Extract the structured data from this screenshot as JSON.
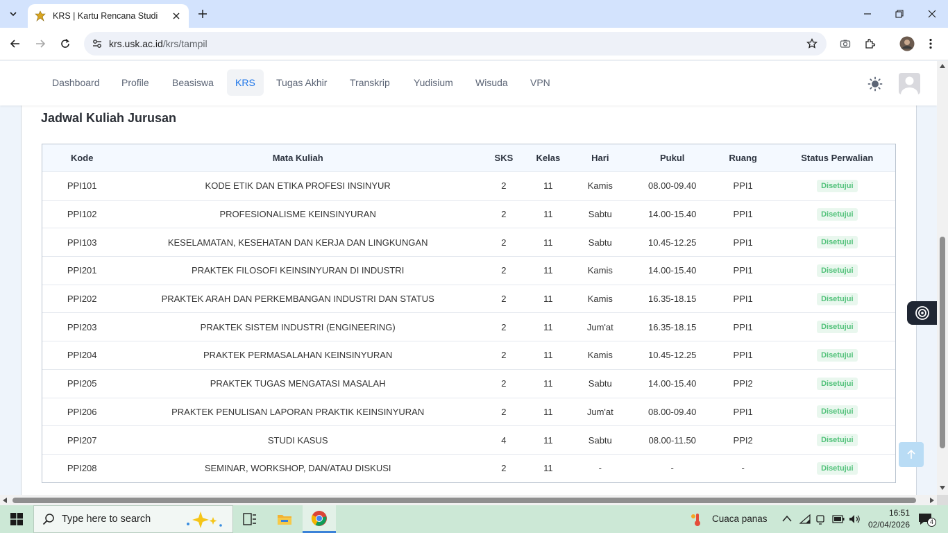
{
  "browser": {
    "tab_title": "KRS | Kartu Rencana Studi",
    "url_host": "krs.usk.ac.id",
    "url_path": "/krs/tampil"
  },
  "nav": {
    "items": [
      {
        "label": "Dashboard"
      },
      {
        "label": "Profile"
      },
      {
        "label": "Beasiswa"
      },
      {
        "label": "KRS"
      },
      {
        "label": "Tugas Akhir"
      },
      {
        "label": "Transkrip"
      },
      {
        "label": "Yudisium"
      },
      {
        "label": "Wisuda"
      },
      {
        "label": "VPN"
      }
    ],
    "active": "KRS"
  },
  "section": {
    "title": "Jadwal Kuliah Jurusan"
  },
  "table": {
    "headers": [
      "Kode",
      "Mata Kuliah",
      "SKS",
      "Kelas",
      "Hari",
      "Pukul",
      "Ruang",
      "Status Perwalian"
    ],
    "rows": [
      {
        "kode": "PPI101",
        "mk": "KODE ETIK DAN ETIKA PROFESI INSINYUR",
        "sks": "2",
        "kelas": "11",
        "hari": "Kamis",
        "pukul": "08.00-09.40",
        "ruang": "PPI1",
        "status": "Disetujui"
      },
      {
        "kode": "PPI102",
        "mk": "PROFESIONALISME KEINSINYURAN",
        "sks": "2",
        "kelas": "11",
        "hari": "Sabtu",
        "pukul": "14.00-15.40",
        "ruang": "PPI1",
        "status": "Disetujui"
      },
      {
        "kode": "PPI103",
        "mk": "KESELAMATAN, KESEHATAN DAN KERJA DAN LINGKUNGAN",
        "sks": "2",
        "kelas": "11",
        "hari": "Sabtu",
        "pukul": "10.45-12.25",
        "ruang": "PPI1",
        "status": "Disetujui"
      },
      {
        "kode": "PPI201",
        "mk": "PRAKTEK FILOSOFI KEINSINYURAN DI INDUSTRI",
        "sks": "2",
        "kelas": "11",
        "hari": "Kamis",
        "pukul": "14.00-15.40",
        "ruang": "PPI1",
        "status": "Disetujui"
      },
      {
        "kode": "PPI202",
        "mk": "PRAKTEK ARAH DAN PERKEMBANGAN INDUSTRI DAN STATUS",
        "sks": "2",
        "kelas": "11",
        "hari": "Kamis",
        "pukul": "16.35-18.15",
        "ruang": "PPI1",
        "status": "Disetujui"
      },
      {
        "kode": "PPI203",
        "mk": "PRAKTEK SISTEM INDUSTRI (ENGINEERING)",
        "sks": "2",
        "kelas": "11",
        "hari": "Jum'at",
        "pukul": "16.35-18.15",
        "ruang": "PPI1",
        "status": "Disetujui"
      },
      {
        "kode": "PPI204",
        "mk": "PRAKTEK PERMASALAHAN KEINSINYURAN",
        "sks": "2",
        "kelas": "11",
        "hari": "Kamis",
        "pukul": "10.45-12.25",
        "ruang": "PPI1",
        "status": "Disetujui"
      },
      {
        "kode": "PPI205",
        "mk": "PRAKTEK TUGAS MENGATASI MASALAH",
        "sks": "2",
        "kelas": "11",
        "hari": "Sabtu",
        "pukul": "14.00-15.40",
        "ruang": "PPI2",
        "status": "Disetujui"
      },
      {
        "kode": "PPI206",
        "mk": "PRAKTEK PENULISAN LAPORAN PRAKTIK KEINSINYURAN",
        "sks": "2",
        "kelas": "11",
        "hari": "Jum'at",
        "pukul": "08.00-09.40",
        "ruang": "PPI1",
        "status": "Disetujui"
      },
      {
        "kode": "PPI207",
        "mk": "STUDI KASUS",
        "sks": "4",
        "kelas": "11",
        "hari": "Sabtu",
        "pukul": "08.00-11.50",
        "ruang": "PPI2",
        "status": "Disetujui"
      },
      {
        "kode": "PPI208",
        "mk": "SEMINAR, WORKSHOP, DAN/ATAU DISKUSI",
        "sks": "2",
        "kelas": "11",
        "hari": "-",
        "pukul": "-",
        "ruang": "-",
        "status": "Disetujui"
      }
    ]
  },
  "taskbar": {
    "search_placeholder": "Type here to search",
    "weather": "Cuaca panas",
    "time": "16:51",
    "date": "02/04/2026",
    "notifications": "4"
  },
  "colors": {
    "accent": "#1a73e8",
    "status_green": "#52c27a",
    "status_bg": "#e9f7ee",
    "tabstrip": "#d3e3fd",
    "taskbar": "#cce8d6"
  }
}
